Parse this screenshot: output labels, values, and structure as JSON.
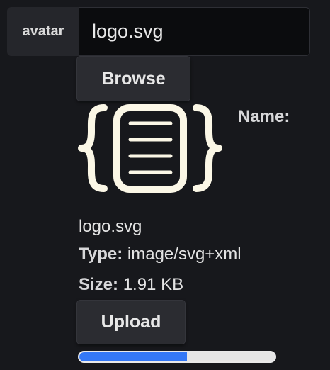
{
  "file_field": {
    "label": "avatar",
    "value": "logo.svg"
  },
  "browse_label": "Browse",
  "preview": {
    "icon": "svg-file-icon",
    "name_label": "Name:"
  },
  "file_info": {
    "name": "logo.svg",
    "type_label": "Type:",
    "type_value": "image/svg+xml",
    "size_label": "Size:",
    "size_value": "1.91 KB"
  },
  "upload_label": "Upload",
  "progress": {
    "percent": 55
  },
  "colors": {
    "background": "#17181c",
    "accent": "#3478f6",
    "icon_stroke": "#fbf7e6"
  }
}
